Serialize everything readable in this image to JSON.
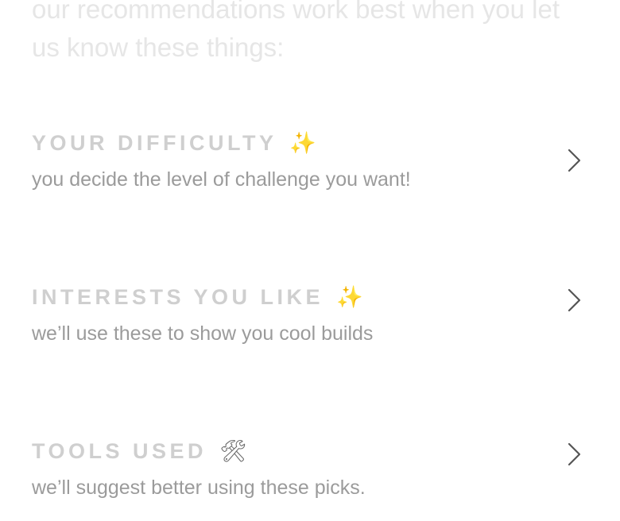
{
  "intro": {
    "text": "our recommendations work best when you let us know these things:"
  },
  "preferences": [
    {
      "title": "YOUR DIFFICULTY",
      "emoji": "✨",
      "description": "you decide the level of challenge you want!",
      "icon": "chevron-right-icon"
    },
    {
      "title": "INTERESTS YOU LIKE",
      "emoji": "✨",
      "description": "we’ll use these to show you cool builds",
      "icon": "chevron-right-icon"
    },
    {
      "title": "TOOLS USED",
      "emoji": "🛠",
      "description": "we’ll suggest better using these picks.",
      "icon": "chevron-right-icon"
    }
  ],
  "colors": {
    "intro_text": "#e6e6e6",
    "title_text": "#cfcfcf",
    "description_text": "#9b9b9b",
    "chevron": "#555555",
    "sparkle": "#f2c12e"
  }
}
